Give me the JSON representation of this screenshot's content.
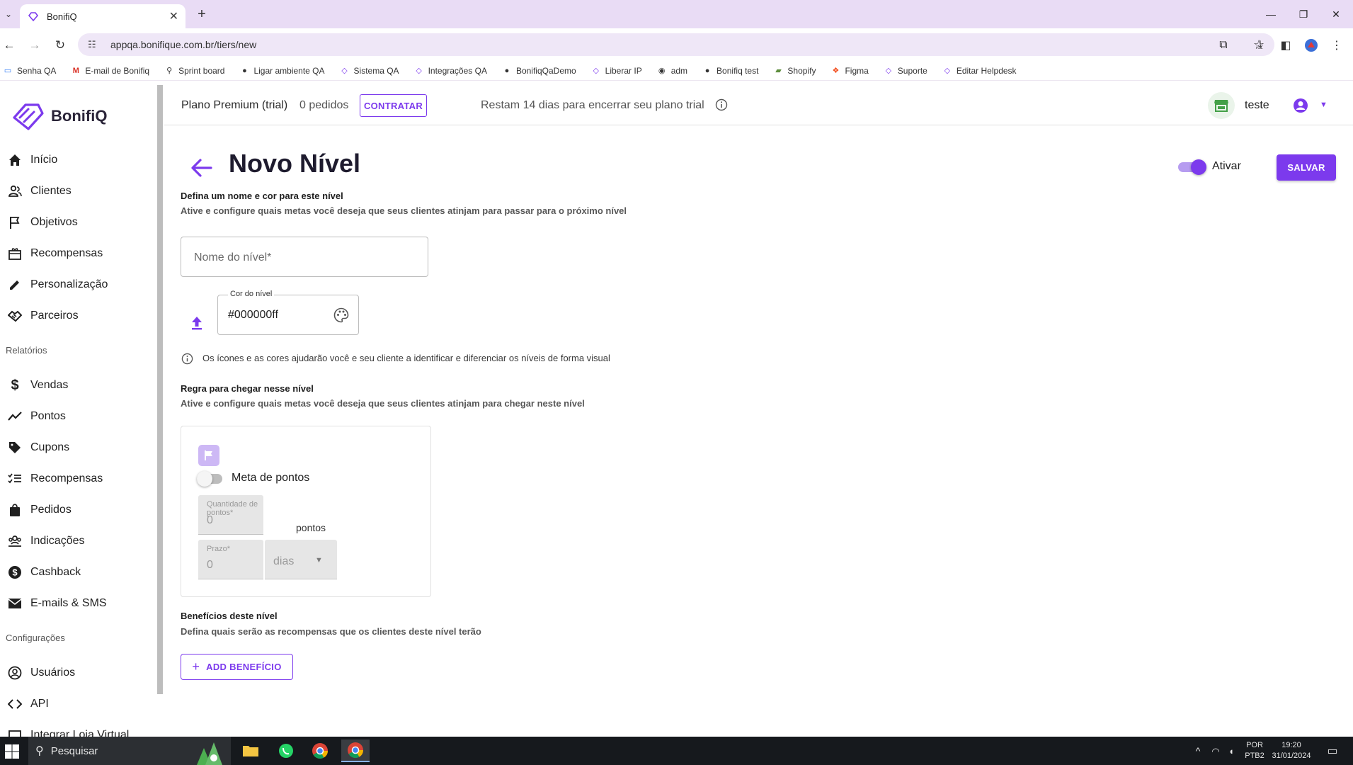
{
  "browser": {
    "tab_title": "BonifiQ",
    "url": "appqa.bonifique.com.br/tiers/new",
    "bookmarks": [
      {
        "label": "Senha QA",
        "icon": "monitor-icon"
      },
      {
        "label": "E-mail de Bonifiq",
        "icon": "gmail-icon"
      },
      {
        "label": "Sprint board",
        "icon": "board-icon"
      },
      {
        "label": "Ligar ambiente QA",
        "icon": "github-icon"
      },
      {
        "label": "Sistema QA",
        "icon": "bonifiq-icon"
      },
      {
        "label": "Integrações QA",
        "icon": "bonifiq-icon"
      },
      {
        "label": "BonifiqQaDemo",
        "icon": "github-icon"
      },
      {
        "label": "Liberar IP",
        "icon": "bonifiq-icon"
      },
      {
        "label": "adm",
        "icon": "eye-icon"
      },
      {
        "label": "Bonifiq test",
        "icon": "github-icon"
      },
      {
        "label": "Shopify",
        "icon": "shopify-icon"
      },
      {
        "label": "Figma",
        "icon": "figma-icon"
      },
      {
        "label": "Suporte",
        "icon": "bonifiq-icon"
      },
      {
        "label": "Editar Helpdesk",
        "icon": "bonifiq-icon"
      }
    ]
  },
  "sidebar": {
    "brand": "BonifiQ",
    "items": [
      {
        "label": "Início",
        "icon": "home-icon"
      },
      {
        "label": "Clientes",
        "icon": "people-icon"
      },
      {
        "label": "Objetivos",
        "icon": "flag-icon"
      },
      {
        "label": "Recompensas",
        "icon": "gift-icon"
      },
      {
        "label": "Personalização",
        "icon": "pencil-icon"
      },
      {
        "label": "Parceiros",
        "icon": "handshake-icon"
      }
    ],
    "section_reports": "Relatórios",
    "reports": [
      {
        "label": "Vendas",
        "icon": "dollar-icon"
      },
      {
        "label": "Pontos",
        "icon": "trend-icon"
      },
      {
        "label": "Cupons",
        "icon": "tag-icon"
      },
      {
        "label": "Recompensas",
        "icon": "checklist-icon"
      },
      {
        "label": "Pedidos",
        "icon": "bag-icon"
      },
      {
        "label": "Indicações",
        "icon": "group-icon"
      },
      {
        "label": "Cashback",
        "icon": "coin-icon"
      },
      {
        "label": "E-mails & SMS",
        "icon": "mail-icon"
      }
    ],
    "section_config": "Configurações",
    "config": [
      {
        "label": "Usuários",
        "icon": "user-circle-icon"
      },
      {
        "label": "API",
        "icon": "code-icon"
      },
      {
        "label": "Integrar Loja Virtual",
        "icon": "store-icon"
      }
    ]
  },
  "header": {
    "plan": "Plano Premium (trial)",
    "orders": "0 pedidos",
    "contratar": "CONTRATAR",
    "trial_notice": "Restam 14 dias para encerrar seu plano trial",
    "user": "teste"
  },
  "page": {
    "title": "Novo Nível",
    "active_label": "Ativar",
    "active": true,
    "save": "SALVAR",
    "section1_title": "Defina um nome e cor para este nível",
    "section1_sub": "Ative e configure quais metas você deseja que seus clientes atinjam para passar para o próximo nível",
    "name_placeholder": "Nome do nível*",
    "color_label": "Cor do nível",
    "color_value": "#000000ff",
    "hint": "Os ícones e as cores ajudarão você e seu cliente a identificar e diferenciar os níveis de forma visual",
    "rule_title": "Regra para chegar nesse nível",
    "rule_sub": "Ative e configure quais metas você deseja que seus clientes atinjam para chegar neste nível",
    "meta_label": "Meta de pontos",
    "meta_enabled": false,
    "points_label": "Quantidade de pontos*",
    "points_value": "0",
    "points_unit": "pontos",
    "deadline_label": "Prazo*",
    "deadline_value": "0",
    "deadline_unit": "dias",
    "benefits_title": "Benefícios deste nível",
    "benefits_sub": "Defina quais serão as recompensas que os clientes deste nível terão",
    "add_benefit": "ADD BENEFÍCIO"
  },
  "taskbar": {
    "search": "Pesquisar",
    "lang1": "POR",
    "lang2": "PTB2",
    "time": "19:20",
    "date": "31/01/2024"
  },
  "colors": {
    "accent": "#7c3aed",
    "accent_light": "#cdb8f5"
  }
}
